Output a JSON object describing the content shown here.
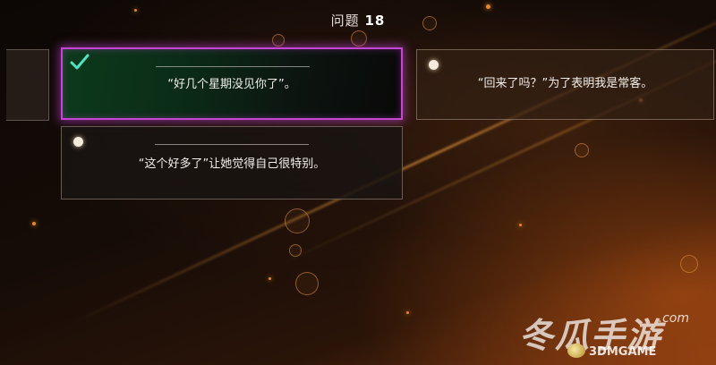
{
  "screen": {
    "title_prefix": "问题",
    "question_number": "18"
  },
  "answers": [
    {
      "text": "“好几个星期没见你了”。",
      "state": "selected-correct"
    },
    {
      "text": "“回来了吗？”为了表明我是常客。",
      "state": "unselected"
    },
    {
      "text": "“这个好多了”让她觉得自己很特别。",
      "state": "unselected"
    }
  ],
  "watermark": {
    "brand": "冬瓜手游",
    "domain": ".com",
    "subtitle": "3DMGAME"
  },
  "colors": {
    "selected_border": "#c646d4",
    "check": "#4fe3c2",
    "background_glow": "#e07a20"
  },
  "icons": {
    "correct": "checkmark-icon",
    "option": "radio-dot-icon"
  }
}
